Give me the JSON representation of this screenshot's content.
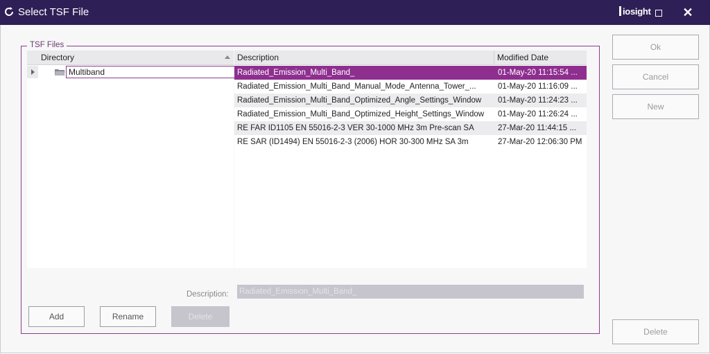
{
  "window": {
    "title": "Select TSF File",
    "brand": "iosight",
    "close_glyph": "✕",
    "icons": [
      "app-refresh-icon",
      "maximize-icon",
      "close-icon"
    ]
  },
  "group": {
    "legend": "TSF Files"
  },
  "directory": {
    "header": "Directory",
    "sort_icon": "sort-ascending-icon",
    "items": [
      {
        "label": "Multiband",
        "icon": "folder-icon"
      }
    ]
  },
  "files": {
    "headers": {
      "description": "Description",
      "modified": "Modified Date"
    },
    "rows": [
      {
        "description": "Radiated_Emission_Multi_Band_",
        "modified": "01-May-20 11:15:54 ...",
        "selected": true
      },
      {
        "description": "Radiated_Emission_Multi_Band_Manual_Mode_Antenna_Tower_...",
        "modified": "01-May-20 11:16:09 ...",
        "selected": false
      },
      {
        "description": "Radiated_Emission_Multi_Band_Optimized_Angle_Settings_Window",
        "modified": "01-May-20 11:24:23 ...",
        "selected": false
      },
      {
        "description": "Radiated_Emission_Multi_Band_Optimized_Height_Settings_Window",
        "modified": "01-May-20 11:26:24 ...",
        "selected": false
      },
      {
        "description": "RE FAR ID1105 EN 55016-2-3 VER 30-1000 MHz 3m Pre-scan SA",
        "modified": "27-Mar-20 11:44:15 ...",
        "selected": false
      },
      {
        "description": "RE SAR (ID1494) EN 55016-2-3 (2006) HOR 30-300 MHz SA 3m",
        "modified": "27-Mar-20 12:06:30 PM",
        "selected": false
      }
    ]
  },
  "description_field": {
    "label": "Description:",
    "value": "Radiated_Emission_Multi_Band_"
  },
  "buttons": {
    "add": "Add",
    "rename": "Rename",
    "delete_bottom": "Delete",
    "ok": "Ok",
    "cancel": "Cancel",
    "new": "New",
    "delete_side": "Delete"
  },
  "colors": {
    "titlebar": "#2e1f56",
    "accent": "#8e2f8f",
    "disabled": "#c6c4cc"
  }
}
